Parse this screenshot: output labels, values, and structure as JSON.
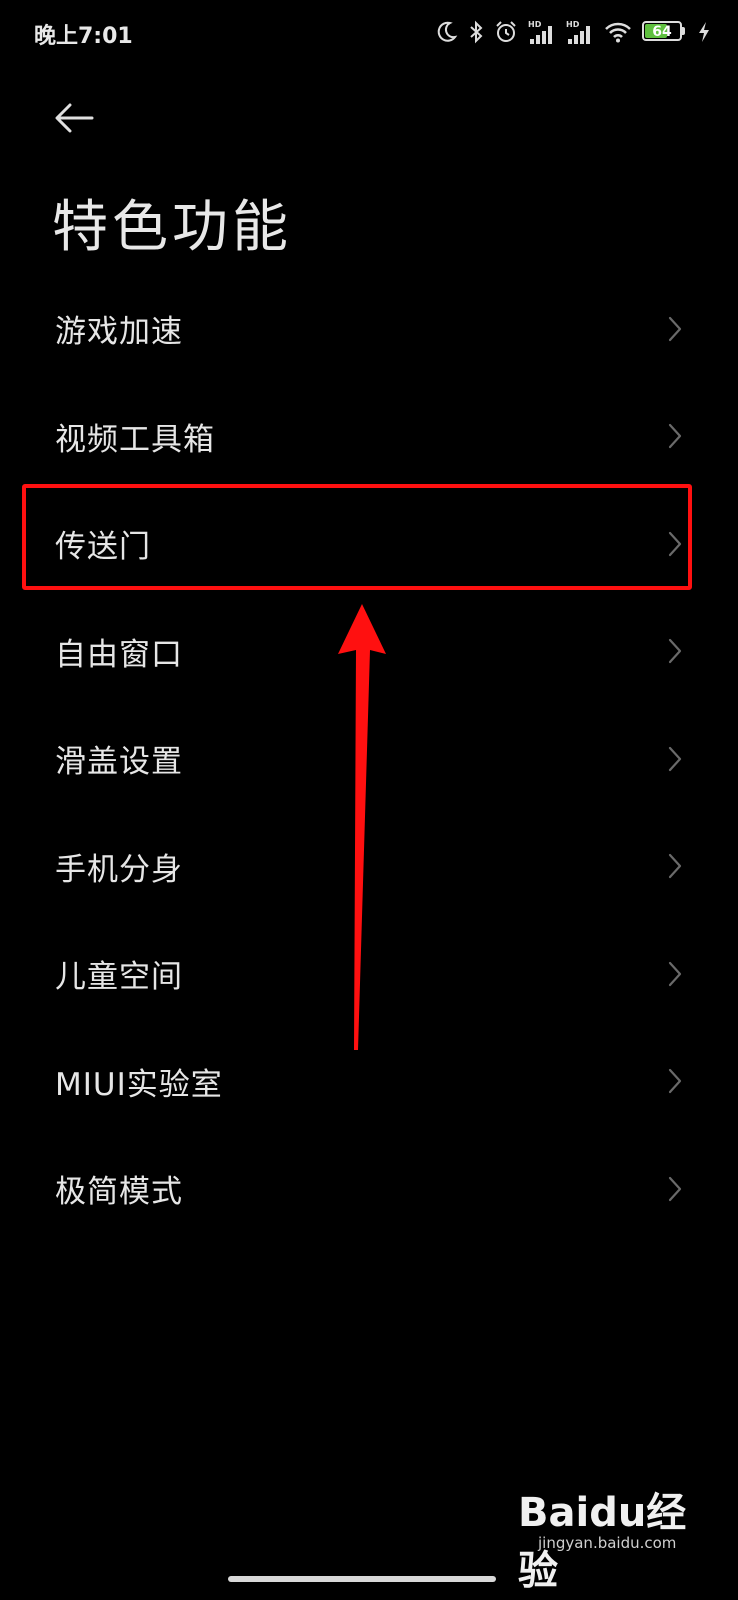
{
  "status_bar": {
    "time": "晚上7:01",
    "battery_level": "64",
    "battery_fraction": 0.64,
    "icons": [
      "moon-icon",
      "bluetooth-icon",
      "alarm-icon",
      "signal-hd-icon",
      "signal-hd-icon",
      "wifi-icon",
      "battery-icon",
      "charging-icon"
    ],
    "hd_label": "HD"
  },
  "header": {
    "back_icon": "arrow-left-icon",
    "title": "特色功能"
  },
  "menu": {
    "items": [
      {
        "label": "游戏加速"
      },
      {
        "label": "视频工具箱"
      },
      {
        "label": "传送门"
      },
      {
        "label": "自由窗口"
      },
      {
        "label": "滑盖设置"
      },
      {
        "label": "手机分身"
      },
      {
        "label": "儿童空间"
      },
      {
        "label": "MIUI实验室"
      },
      {
        "label": "极简模式"
      }
    ],
    "highlighted_index": 2
  },
  "annotation": {
    "box_color": "#ff1010",
    "arrow_color": "#ff1010"
  },
  "watermark": {
    "brand": "Baidu经验",
    "sub": "jingyan.baidu.com"
  },
  "colors": {
    "background": "#000000",
    "text": "#e6e6e6",
    "chevron": "#6a6a6a",
    "battery_fill": "#5fbf3f"
  }
}
